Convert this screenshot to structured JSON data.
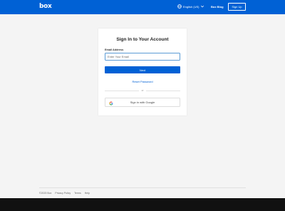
{
  "header": {
    "logo": "box",
    "language": "English (US)",
    "blog": "Box Blog",
    "signup": "Sign Up"
  },
  "signin": {
    "title": "Sign In to Your Account",
    "email_label": "Email Address",
    "email_placeholder": "Enter Your Email",
    "next": "Next",
    "reset": "Reset Password",
    "or": "or",
    "google": "Sign in with Google"
  },
  "footer": {
    "links": [
      "©2023 Box",
      "Privacy Policy",
      "Terms",
      "Help"
    ]
  },
  "colors": {
    "brand": "#0061d5",
    "bottom_bar": "#111111"
  },
  "icons": [
    "globe-icon",
    "chevron-down-icon",
    "google-icon"
  ]
}
